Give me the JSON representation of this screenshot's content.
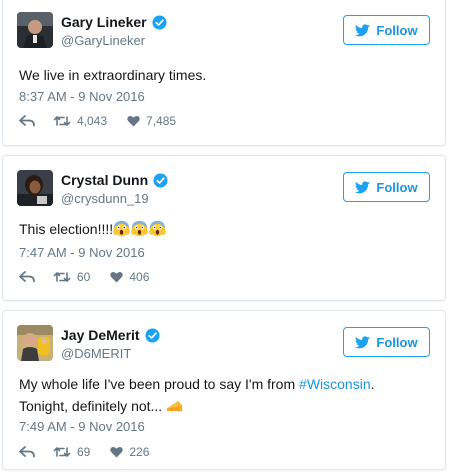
{
  "tweets": [
    {
      "name": "Gary Lineker",
      "handle": "@GaryLineker",
      "text": "We live in extraordinary times.",
      "time": "8:37 AM - 9 Nov 2016",
      "retweets": "4,043",
      "likes": "7,485",
      "follow_label": "Follow"
    },
    {
      "name": "Crystal Dunn",
      "handle": "@crysdunn_19",
      "text": "This election!!!!",
      "emoji": "face-screaming-in-fear-emoji",
      "time": "7:47 AM - 9 Nov 2016",
      "retweets": "60",
      "likes": "406",
      "follow_label": "Follow"
    },
    {
      "name": "Jay DeMerit",
      "handle": "@D6MERIT",
      "text_before_hashtag": "My whole life I've been proud to say I'm from ",
      "hashtag": "#Wisconsin",
      "text_after_hashtag": ".",
      "text_line2": "Tonight, definitely not... ",
      "emoji": "cheese-emoji",
      "time": "7:49 AM - 9 Nov 2016",
      "retweets": "69",
      "likes": "226",
      "follow_label": "Follow"
    }
  ],
  "colors": {
    "accent": "#1da1f2",
    "link": "#1b95e0",
    "muted": "#657786",
    "border": "#e1e8ed"
  }
}
